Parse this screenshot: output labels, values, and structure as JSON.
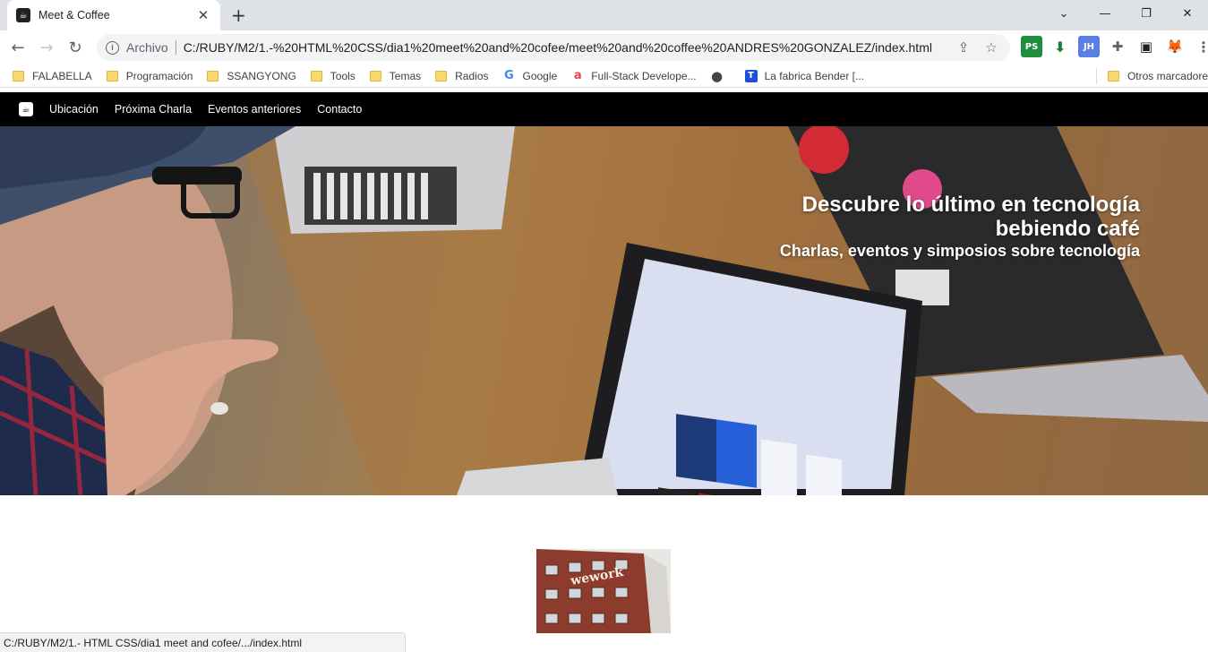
{
  "browser": {
    "tab": {
      "title": "Meet & Coffee",
      "favicon": "coffee-icon"
    },
    "new_tab_label": "+",
    "window_controls": [
      "⌄",
      "—",
      "❐",
      "✕"
    ],
    "address_bar": {
      "origin_label": "Archivo",
      "url": "C:/RUBY/M2/1.-%20HTML%20CSS/dia1%20meet%20and%20cofee/meet%20and%20coffee%20ANDRES%20GONZALEZ/index.html"
    },
    "extensions": [
      {
        "name": "ps-extension",
        "label": "PS",
        "color": "#1e8e3e"
      },
      {
        "name": "download-extension",
        "label": "⬇",
        "color": "#188038"
      },
      {
        "name": "jh-extension",
        "label": "JH",
        "color": "#5b7ee5"
      },
      {
        "name": "puzzle-extension",
        "label": "✚",
        "color": "#5f6368"
      },
      {
        "name": "sidepanel-extension",
        "label": "▣",
        "color": "#202124"
      },
      {
        "name": "fox-extension",
        "label": "🦊",
        "color": "#e8710a"
      }
    ],
    "bookmarks": [
      {
        "label": "FALABELLA",
        "type": "folder"
      },
      {
        "label": "Programación",
        "type": "folder"
      },
      {
        "label": "SSANGYONG",
        "type": "folder"
      },
      {
        "label": "Tools",
        "type": "folder"
      },
      {
        "label": "Temas",
        "type": "folder"
      },
      {
        "label": "Radios",
        "type": "folder"
      },
      {
        "label": "Google",
        "type": "site",
        "icon": "G",
        "color": "#4285f4"
      },
      {
        "label": "Full-Stack Develope...",
        "type": "site",
        "icon": "a",
        "color": "#e5484d"
      },
      {
        "label": "",
        "type": "site",
        "icon": "●",
        "color": "#444444"
      },
      {
        "label": "La fabrica Bender [...",
        "type": "site",
        "icon": "T",
        "color": "#1d4ed8"
      }
    ],
    "other_bookmarks": "Otros marcadore",
    "status_text": "C:/RUBY/M2/1.- HTML CSS/dia1 meet and cofee/.../index.html"
  },
  "site": {
    "nav": {
      "logo": "coffee-logo",
      "links": [
        "Ubicación",
        "Próxima Charla",
        "Eventos anteriores",
        "Contacto"
      ]
    },
    "hero": {
      "title": "Descubre lo último en tecnología bebiendo café",
      "subtitle": "Charlas, eventos y simposios sobre tecnología"
    },
    "location_photo": {
      "sign": "wework"
    }
  }
}
